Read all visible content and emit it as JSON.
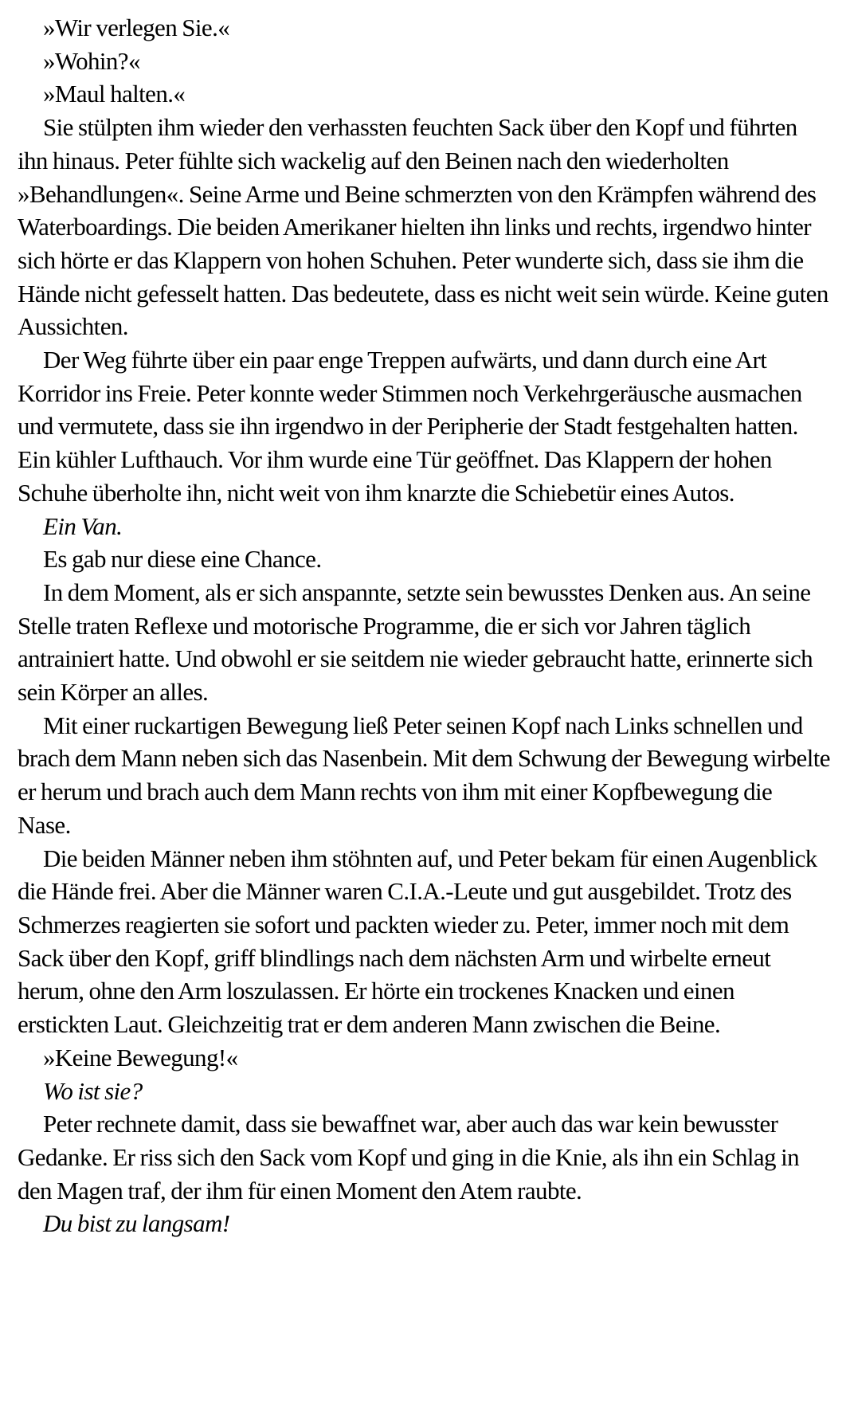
{
  "paragraphs": [
    {
      "text": "»Wir verlegen Sie.«",
      "italic": false
    },
    {
      "text": "»Wohin?«",
      "italic": false
    },
    {
      "text": "»Maul halten.«",
      "italic": false
    },
    {
      "text": "Sie stülpten ihm wieder den verhassten feuchten Sack über den Kopf und führten ihn hinaus. Peter fühlte sich wackelig auf den Beinen nach den wiederholten »Behandlungen«. Seine Arme und Beine schmerzten von den Krämpfen während des Waterboardings. Die beiden Amerikaner hielten ihn links und rechts, irgendwo hinter sich hörte er das Klappern von hohen Schuhen. Peter wunderte sich, dass sie ihm die Hände nicht gefesselt hatten. Das bedeutete, dass es nicht weit sein würde. Keine guten Aussichten.",
      "italic": false
    },
    {
      "text": "Der Weg führte über ein paar enge Treppen aufwärts, und dann durch eine Art Korridor ins Freie. Peter konnte weder Stimmen noch Verkehrgeräusche ausmachen und vermutete, dass sie ihn irgendwo in der Peripherie der Stadt festgehalten hatten. Ein kühler Lufthauch. Vor ihm wurde eine Tür geöffnet. Das Klappern der hohen Schuhe überholte ihn, nicht weit von ihm knarzte die Schiebetür eines Autos.",
      "italic": false
    },
    {
      "text": "Ein Van.",
      "italic": true
    },
    {
      "text": "Es gab nur diese eine Chance.",
      "italic": false
    },
    {
      "text": "In dem Moment, als er sich anspannte, setzte sein bewusstes Denken aus. An seine Stelle traten Reflexe und motorische Programme, die er sich vor Jahren täglich antrainiert hatte. Und obwohl er sie seitdem nie wieder gebraucht hatte, erinnerte sich sein Körper an alles.",
      "italic": false
    },
    {
      "text": "Mit einer ruckartigen Bewegung ließ Peter seinen Kopf nach Links schnellen und brach dem Mann neben sich das Nasenbein. Mit dem Schwung der Bewegung wirbelte er herum und brach auch dem Mann rechts von ihm mit einer Kopfbewegung die Nase.",
      "italic": false
    },
    {
      "text": "Die beiden Männer neben ihm stöhnten auf, und Peter bekam für einen Augenblick die Hände frei. Aber die Männer waren C.I.A.-Leute und gut ausgebildet. Trotz des Schmerzes reagierten sie sofort und packten wieder zu. Peter, immer noch mit dem Sack über den Kopf, griff blindlings nach dem nächsten Arm und wirbelte erneut herum, ohne den Arm loszulassen. Er hörte ein trockenes Knacken und einen erstickten Laut. Gleichzeitig trat er dem anderen Mann zwischen die Beine.",
      "italic": false
    },
    {
      "text": "»Keine Bewegung!«",
      "italic": false
    },
    {
      "text": "Wo ist sie?",
      "italic": true
    },
    {
      "text": "Peter rechnete damit, dass sie bewaffnet war, aber auch das war kein bewusster Gedanke. Er riss sich den Sack vom Kopf und ging in die Knie, als ihn ein Schlag in den Magen traf, der ihm für einen Moment den Atem raubte.",
      "italic": false
    },
    {
      "text": "Du bist zu langsam!",
      "italic": true
    }
  ]
}
